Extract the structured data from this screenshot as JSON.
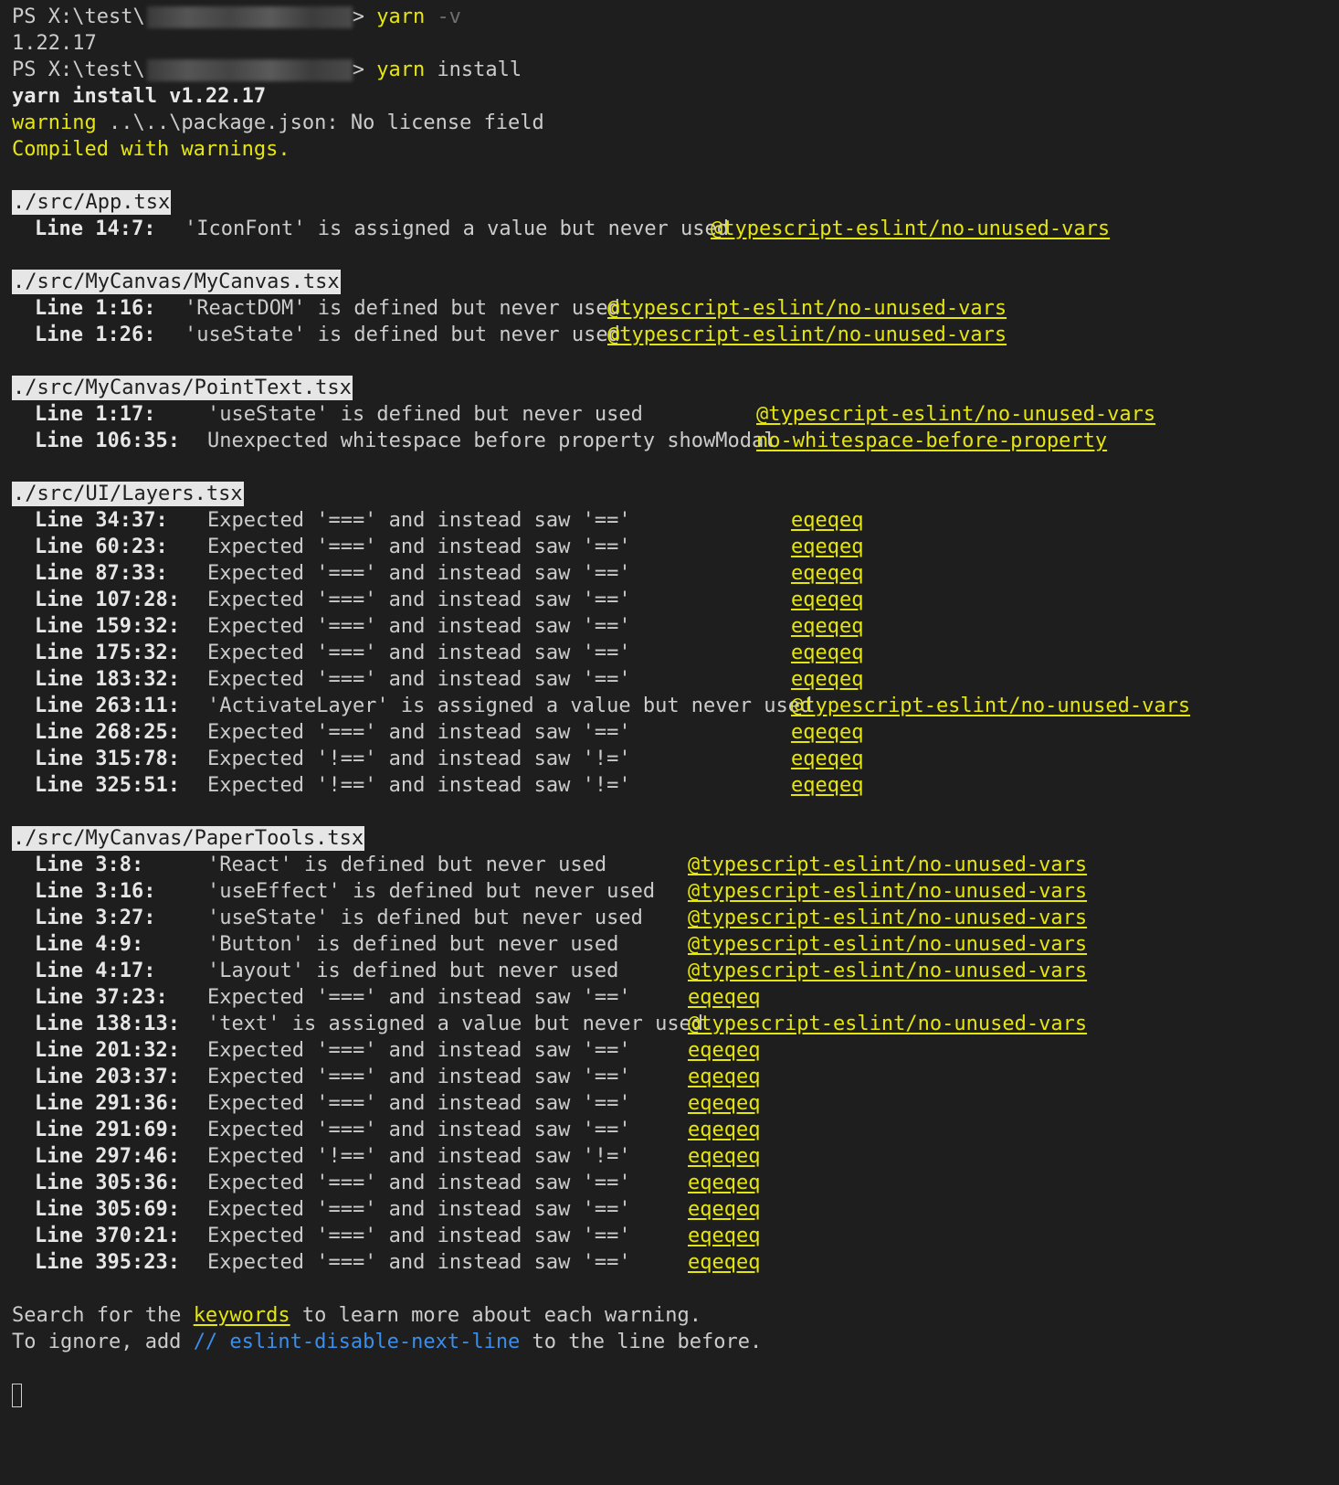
{
  "terminal": {
    "prompt1": {
      "prefix": "PS X:\\test\\",
      "arrow": ">",
      "command": "yarn",
      "flag": "-v"
    },
    "version_output": "1.22.17",
    "prompt2": {
      "prefix": "PS X:\\test\\",
      "arrow": ">",
      "command": "yarn",
      "args": "install"
    },
    "install_header": "yarn install v1.22.17",
    "warning_word": "warning",
    "warning_text": " ..\\..\\package.json: No license field",
    "compiled": "Compiled with warnings.",
    "footer": {
      "line1_pre": "Search for the ",
      "line1_kw": "keywords",
      "line1_post": " to learn more about each warning.",
      "line2_pre": "To ignore, add ",
      "line2_code": "// eslint-disable-next-line",
      "line2_post": " to the line before."
    }
  },
  "files": [
    {
      "path": "./src/App.tsx",
      "warnings": [
        {
          "loc": "Line 14:7:",
          "msg": "'IconFont' is assigned a value but never used",
          "rule": "@typescript-eslint/no-unused-vars"
        }
      ]
    },
    {
      "path": "./src/MyCanvas/MyCanvas.tsx",
      "warnings": [
        {
          "loc": "Line 1:16:",
          "msg": "'ReactDOM' is defined but never used",
          "rule": "@typescript-eslint/no-unused-vars"
        },
        {
          "loc": "Line 1:26:",
          "msg": "'useState' is defined but never used",
          "rule": "@typescript-eslint/no-unused-vars"
        }
      ]
    },
    {
      "path": "./src/MyCanvas/PointText.tsx",
      "warnings": [
        {
          "loc": "Line 1:17:",
          "msg": "'useState' is defined but never used",
          "rule": "@typescript-eslint/no-unused-vars"
        },
        {
          "loc": "Line 106:35:",
          "msg": "Unexpected whitespace before property showModal",
          "rule": "no-whitespace-before-property"
        }
      ]
    },
    {
      "path": "./src/UI/Layers.tsx",
      "warnings": [
        {
          "loc": "Line 34:37:",
          "msg": "Expected '===' and instead saw '=='",
          "rule": "eqeqeq"
        },
        {
          "loc": "Line 60:23:",
          "msg": "Expected '===' and instead saw '=='",
          "rule": "eqeqeq"
        },
        {
          "loc": "Line 87:33:",
          "msg": "Expected '===' and instead saw '=='",
          "rule": "eqeqeq"
        },
        {
          "loc": "Line 107:28:",
          "msg": "Expected '===' and instead saw '=='",
          "rule": "eqeqeq"
        },
        {
          "loc": "Line 159:32:",
          "msg": "Expected '===' and instead saw '=='",
          "rule": "eqeqeq"
        },
        {
          "loc": "Line 175:32:",
          "msg": "Expected '===' and instead saw '=='",
          "rule": "eqeqeq"
        },
        {
          "loc": "Line 183:32:",
          "msg": "Expected '===' and instead saw '=='",
          "rule": "eqeqeq"
        },
        {
          "loc": "Line 263:11:",
          "msg": "'ActivateLayer' is assigned a value but never used",
          "rule": "@typescript-eslint/no-unused-vars"
        },
        {
          "loc": "Line 268:25:",
          "msg": "Expected '===' and instead saw '=='",
          "rule": "eqeqeq"
        },
        {
          "loc": "Line 315:78:",
          "msg": "Expected '!==' and instead saw '!='",
          "rule": "eqeqeq"
        },
        {
          "loc": "Line 325:51:",
          "msg": "Expected '!==' and instead saw '!='",
          "rule": "eqeqeq"
        }
      ]
    },
    {
      "path": "./src/MyCanvas/PaperTools.tsx",
      "warnings": [
        {
          "loc": "Line 3:8:",
          "msg": "'React' is defined but never used",
          "rule": "@typescript-eslint/no-unused-vars"
        },
        {
          "loc": "Line 3:16:",
          "msg": "'useEffect' is defined but never used",
          "rule": "@typescript-eslint/no-unused-vars"
        },
        {
          "loc": "Line 3:27:",
          "msg": "'useState' is defined but never used",
          "rule": "@typescript-eslint/no-unused-vars"
        },
        {
          "loc": "Line 4:9:",
          "msg": "'Button' is defined but never used",
          "rule": "@typescript-eslint/no-unused-vars"
        },
        {
          "loc": "Line 4:17:",
          "msg": "'Layout' is defined but never used",
          "rule": "@typescript-eslint/no-unused-vars"
        },
        {
          "loc": "Line 37:23:",
          "msg": "Expected '===' and instead saw '=='",
          "rule": "eqeqeq"
        },
        {
          "loc": "Line 138:13:",
          "msg": "'text' is assigned a value but never used",
          "rule": "@typescript-eslint/no-unused-vars"
        },
        {
          "loc": "Line 201:32:",
          "msg": "Expected '===' and instead saw '=='",
          "rule": "eqeqeq"
        },
        {
          "loc": "Line 203:37:",
          "msg": "Expected '===' and instead saw '=='",
          "rule": "eqeqeq"
        },
        {
          "loc": "Line 291:36:",
          "msg": "Expected '===' and instead saw '=='",
          "rule": "eqeqeq"
        },
        {
          "loc": "Line 291:69:",
          "msg": "Expected '===' and instead saw '=='",
          "rule": "eqeqeq"
        },
        {
          "loc": "Line 297:46:",
          "msg": "Expected '!==' and instead saw '!='",
          "rule": "eqeqeq"
        },
        {
          "loc": "Line 305:36:",
          "msg": "Expected '===' and instead saw '=='",
          "rule": "eqeqeq"
        },
        {
          "loc": "Line 305:69:",
          "msg": "Expected '===' and instead saw '=='",
          "rule": "eqeqeq"
        },
        {
          "loc": "Line 370:21:",
          "msg": "Expected '===' and instead saw '=='",
          "rule": "eqeqeq"
        },
        {
          "loc": "Line 395:23:",
          "msg": "Expected '===' and instead saw '=='",
          "rule": "eqeqeq"
        }
      ]
    }
  ],
  "colors": {
    "background": "#1e1e1e",
    "foreground": "#cccccc",
    "yellow": "#e5e510",
    "blue": "#3b8eea"
  }
}
